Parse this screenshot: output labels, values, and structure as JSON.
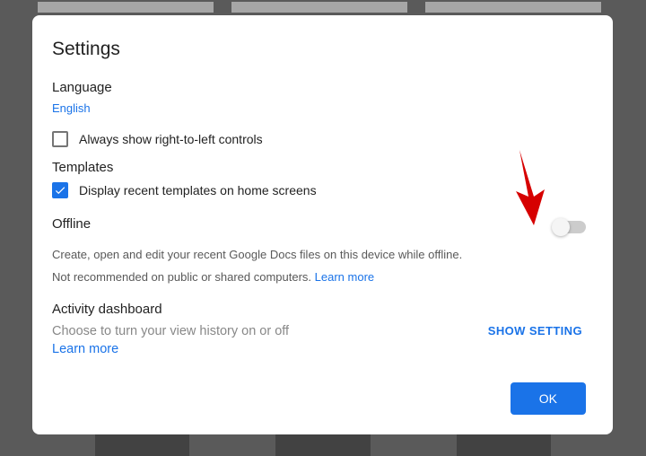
{
  "dialog": {
    "title": "Settings",
    "language": {
      "heading": "Language",
      "value": "English",
      "rtl_label": "Always show right-to-left controls",
      "rtl_checked": false
    },
    "templates": {
      "heading": "Templates",
      "recent_label": "Display recent templates on home screens",
      "recent_checked": true
    },
    "offline": {
      "heading": "Offline",
      "desc": "Create, open and edit your recent Google Docs files on this device while offline.",
      "note": "Not recommended on public or shared computers. ",
      "learn_more": "Learn more",
      "toggle_on": false
    },
    "activity": {
      "heading": "Activity dashboard",
      "desc": "Choose to turn your view history on or off",
      "learn_more": "Learn more",
      "show_setting": "SHOW SETTING"
    },
    "ok_label": "OK"
  },
  "annotation": {
    "arrow_color": "#d60000"
  }
}
